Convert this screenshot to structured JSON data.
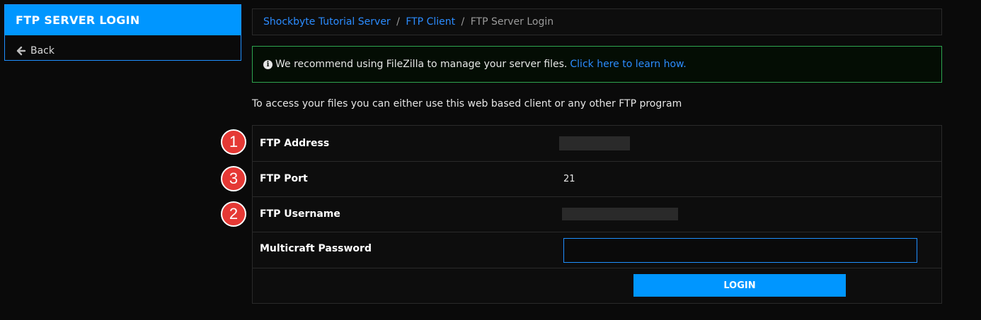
{
  "sidebar": {
    "title": "FTP SERVER LOGIN",
    "back_label": "Back"
  },
  "breadcrumb": {
    "items": [
      "Shockbyte Tutorial Server",
      "FTP Client"
    ],
    "current": "FTP Server Login",
    "separator": "/"
  },
  "alert": {
    "text": "We recommend using FileZilla to manage your server files.",
    "link_text": "Click here to learn how."
  },
  "intro": "To access your files you can either use this web based client or any other FTP program",
  "form": {
    "address_label": "FTP Address",
    "port_label": "FTP Port",
    "port_value": "21",
    "username_label": "FTP Username",
    "password_label": "Multicraft Password",
    "password_value": "",
    "login_label": "LOGIN"
  },
  "markers": [
    "1",
    "3",
    "2"
  ],
  "colors": {
    "accent": "#0096ff",
    "alert_border": "#2ea44f",
    "marker": "#e53935"
  }
}
